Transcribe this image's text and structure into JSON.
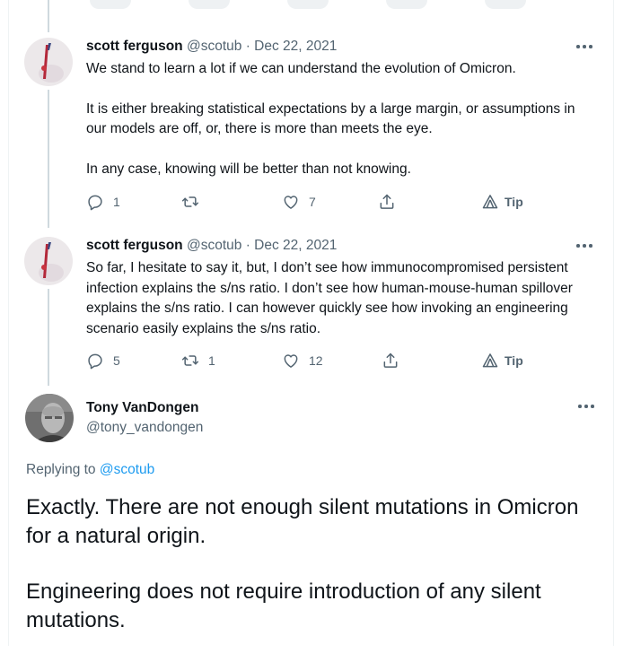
{
  "tweets": [
    {
      "name": "scott ferguson",
      "handle": "@scotub",
      "date": "Dec 22, 2021",
      "paragraphs": [
        "We stand to learn a lot if we can understand the evolution of Omicron.",
        "It is either breaking statistical expectations by a large margin, or assumptions in our models are off, or, there is more than meets the eye.",
        "In any case, knowing will be better than not knowing."
      ],
      "replies": "1",
      "retweets": "",
      "likes": "7",
      "tip_label": "Tip"
    },
    {
      "name": "scott ferguson",
      "handle": "@scotub",
      "date": "Dec 22, 2021",
      "paragraphs": [
        "So far, I hesitate to say it, but, I don’t see how immunocompromised persistent infection explains the s/ns ratio. I don’t see how human-mouse-human spillover explains the s/ns ratio. I can however quickly see how invoking an engineering scenario easily explains the s/ns ratio."
      ],
      "replies": "5",
      "retweets": "1",
      "likes": "12",
      "tip_label": "Tip"
    }
  ],
  "main_tweet": {
    "name": "Tony VanDongen",
    "handle": "@tony_vandongen",
    "replying_prefix": "Replying to",
    "replying_to": "@scotub",
    "paragraphs": [
      "Exactly. There are not enough silent mutations in Omicron for a natural origin.",
      "Engineering does not require introduction of any silent mutations."
    ]
  },
  "separator": "·",
  "icons": [
    "reply-icon",
    "retweet-icon",
    "like-icon",
    "share-icon",
    "tip-icon",
    "more-icon"
  ],
  "colors": {
    "text": "#0f1419",
    "secondary": "#536471",
    "link": "#1d9bf0",
    "thread_line": "#cfd9de"
  }
}
